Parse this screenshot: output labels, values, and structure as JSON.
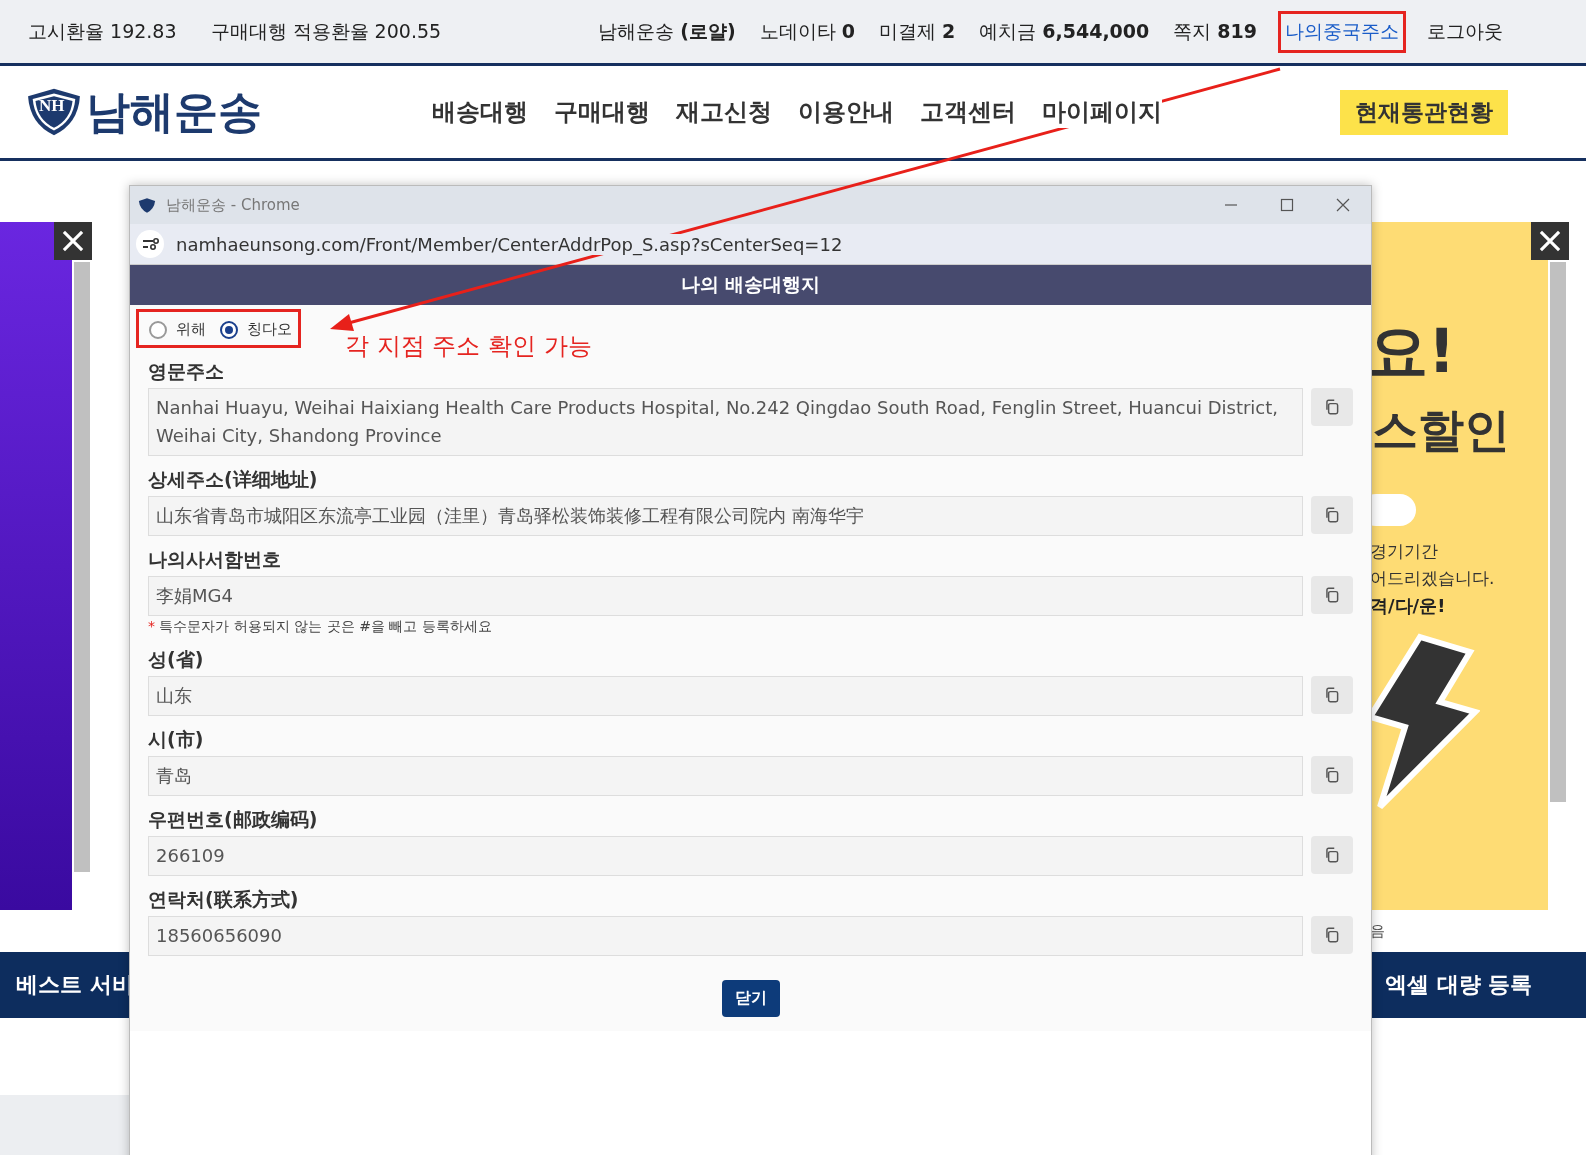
{
  "top_bar": {
    "left": [
      "고시환율 192.83",
      "구매대행 적용환율 200.55"
    ],
    "right": [
      {
        "text": "남해운송 **(로얄)**",
        "kind": "info",
        "boxed": false
      },
      {
        "text": "노데이타 **0**",
        "kind": "info",
        "boxed": false
      },
      {
        "text": "미결제 **2**",
        "kind": "info",
        "boxed": false
      },
      {
        "text": "예치금 **6,544,000**",
        "kind": "info",
        "boxed": false
      },
      {
        "text": "쪽지 **819**",
        "kind": "info",
        "boxed": false
      },
      {
        "text": "나의중국주소",
        "kind": "link",
        "boxed": true
      },
      {
        "text": "로그아웃",
        "kind": "plain",
        "boxed": false
      }
    ]
  },
  "header": {
    "logo_text": "남해운송",
    "logo_mark": "NH",
    "menu": [
      "배송대행",
      "구매대행",
      "재고신청",
      "이용안내",
      "고객센터",
      "마이페이지"
    ],
    "status_button": "현재통관현황"
  },
  "left_banner": {
    "bottom_bar": "베스트 서비"
  },
  "right_banner": {
    "texts": [
      "요!",
      "스할인",
      "경기기간",
      "어드리겠습니다.",
      "격/다/운!"
    ],
    "below": "음",
    "bottom_bar": "엑셀 대량 등록"
  },
  "popup": {
    "window_title": "남해운송 - Chrome",
    "url": "namhaeunsong.com/Front/Member/CenterAddrPop_S.asp?sCenterSeq=12",
    "header": "나의 배송대행지",
    "branches": [
      {
        "label": "위해",
        "selected": false
      },
      {
        "label": "칭다오",
        "selected": true
      }
    ],
    "annotation": "각 지점 주소 확인 가능",
    "fields": [
      {
        "label": "영문주소",
        "value": "Nanhai Huayu, Weihai Haixiang Health Care Products Hospital, No.242 Qingdao South Road, Fenglin Street, Huancui District, Weihai City, Shandong Province"
      },
      {
        "label": "상세주소(详细地址)",
        "value": "山东省青岛市城阳区东流亭工业园（洼里）青岛驿松装饰装修工程有限公司院内 南海华宇"
      },
      {
        "label": "나의사서함번호",
        "value": "李娟MG4",
        "note_mark": "*",
        "note": "특수문자가 허용되지 않는 곳은 #을 빼고 등록하세요"
      },
      {
        "label": "성(省)",
        "value": "山东"
      },
      {
        "label": "시(市)",
        "value": "青岛"
      },
      {
        "label": "우편번호(邮政编码)",
        "value": "266109"
      },
      {
        "label": "연락처(联系方式)",
        "value": "18560656090"
      }
    ],
    "close_button": "닫기"
  }
}
